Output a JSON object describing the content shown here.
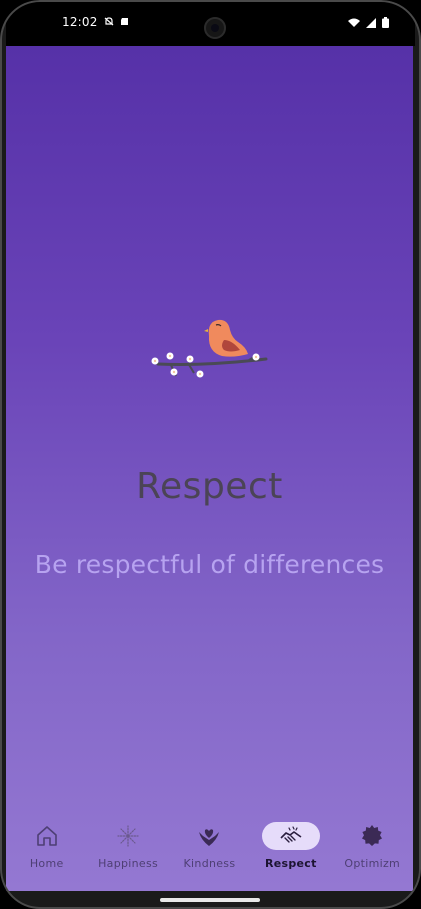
{
  "status_bar": {
    "time": "12:02",
    "left_icons": [
      "notification-off-icon",
      "sd-card-icon"
    ],
    "right_icons": [
      "wifi-icon",
      "signal-icon",
      "battery-icon"
    ]
  },
  "content": {
    "title": "Respect",
    "subtitle": "Be respectful of differences",
    "illustration": "bird-on-branch-icon"
  },
  "colors": {
    "gradient_top": "#5631a8",
    "gradient_bottom": "#9478d2",
    "title": "#4b4456",
    "subtitle": "#b7a3f0",
    "active_pill": "#e6dcfa"
  },
  "bottom_nav": {
    "items": [
      {
        "label": "Home",
        "icon": "home-icon",
        "active": false
      },
      {
        "label": "Happiness",
        "icon": "fireworks-icon",
        "active": false
      },
      {
        "label": "Kindness",
        "icon": "heart-hands-icon",
        "active": false
      },
      {
        "label": "Respect",
        "icon": "handshake-icon",
        "active": true
      },
      {
        "label": "Optimizm",
        "icon": "sun-badge-icon",
        "active": false
      }
    ]
  }
}
